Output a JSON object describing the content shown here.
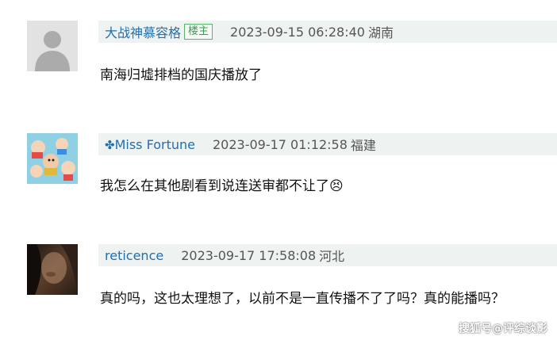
{
  "comments": [
    {
      "username": "大战神慕容格",
      "badge": "楼主",
      "time": "2023-09-15 06:28:40",
      "location": "湖南",
      "content": "南海归墟排档的国庆播放了"
    },
    {
      "username_icon": "clover-icon",
      "username": "Miss Fortune",
      "time": "2023-09-17 01:12:58",
      "location": "福建",
      "content": "我怎么在其他剧看到说连送审都不让了😣"
    },
    {
      "username": "reticence",
      "time": "2023-09-17 17:58:08",
      "location": "河北",
      "content": "真的吗，这也太理想了，以前不是一直传播不了了吗？真的能播吗？"
    }
  ],
  "watermark": "搜狐号@评综谈影",
  "colors": {
    "header_bg": "#eef3f2",
    "username": "#1f6fb2",
    "badge_border": "#58b36b"
  }
}
